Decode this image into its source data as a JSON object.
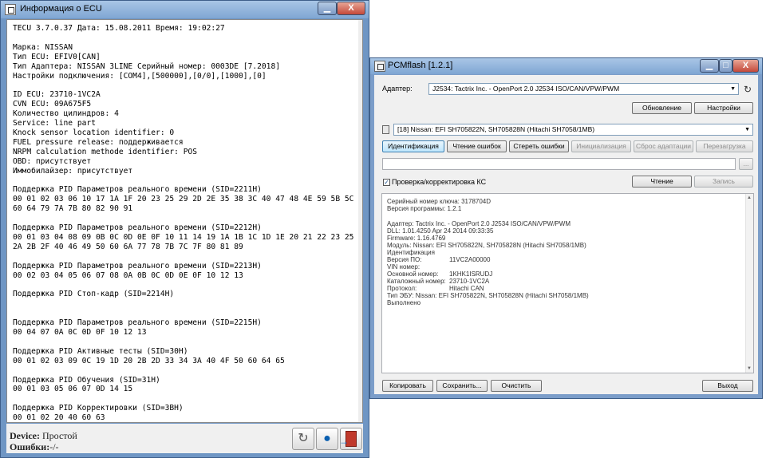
{
  "ecu_window": {
    "title": "Информация о ECU",
    "title_buttons": {
      "minimize": "▁",
      "maximize": "□",
      "close": "X"
    },
    "lines": [
      "TECU 3.7.0.37 Дата: 15.08.2011 Время: 19:02:27",
      "",
      "Марка: NISSAN",
      "Тип ECU: EFIV0[CAN]",
      "Тип Адаптера: NISSAN 3LINE Серийный номер: 0003DE [7.2018]",
      "Настройки подключения: [COM4],[500000],[0/0],[1000],[0]",
      "",
      "ID ECU: 23710-1VC2A",
      "CVN ECU: 09A675F5",
      "Количество цилиндров: 4",
      "Service: line part",
      "Knock sensor location identifier: 0",
      "FUEL pressure release: поддерживается",
      "NRPM calculation methode identifier: POS",
      "OBD: присутствует",
      "Иммобилайзер: присутствует",
      "",
      "Поддержка PID Параметров реального времени (SID=2211H)",
      "00 01 02 03 06 10 17 1A 1F 20 23 25 29 2D 2E 35 38 3C 40 47 48 4E 59 5B 5C",
      "60 64 79 7A 7B 80 82 90 91",
      "",
      "Поддержка PID Параметров реального времени (SID=2212H)",
      "00 01 03 04 08 09 0B 0C 0D 0E 0F 10 11 14 19 1A 1B 1C 1D 1E 20 21 22 23 25",
      "2A 2B 2F 40 46 49 50 60 6A 77 78 7B 7C 7F 80 81 89",
      "",
      "Поддержка PID Параметров реального времени (SID=2213H)",
      "00 02 03 04 05 06 07 08 0A 0B 0C 0D 0E 0F 10 12 13",
      "",
      "Поддержка PID Стоп-кадр (SID=2214H)",
      "",
      "",
      "Поддержка PID Параметров реального времени (SID=2215H)",
      "00 04 07 0A 0C 0D 0F 10 12 13",
      "",
      "Поддержка PID Активные тесты (SID=30H)",
      "00 01 02 03 09 0C 19 1D 20 2B 2D 33 34 3A 40 4F 50 60 64 65",
      "",
      "Поддержка PID Обучения (SID=31H)",
      "00 01 03 05 06 07 0D 14 15",
      "",
      "Поддержка PID Корректировки (SID=3BH)",
      "00 01 02 20 40 60 63"
    ],
    "device_label": "Device:",
    "device_value": "Простой",
    "errors_label": "Ошибки:",
    "errors_value": "-/-"
  },
  "pcm_window": {
    "title": "PCMflash [1.2.1]",
    "title_buttons": {
      "minimize": "▁",
      "maximize": "□",
      "close": "X"
    },
    "adapter_label": "Адаптер:",
    "adapter_value": "J2534: Tactrix Inc. - OpenPort 2.0 J2534 ISO/CAN/VPW/PWM",
    "update_button": "Обновление",
    "settings_button": "Настройки",
    "module_value": "[18] Nissan: EFI SH705822N, SH705828N (Hitachi SH7058/1MB)",
    "tabs": [
      "Идентификация",
      "Чтение ошибок",
      "Стереть ошибки",
      "Инициализация",
      "Сброс адаптации",
      "Перезагрузка"
    ],
    "browse_button": "...",
    "checksum_checkbox_label": "Проверка/корректировка КС",
    "read_button": "Чтение",
    "write_button": "Запись",
    "log": {
      "key_serial": "Серийный номер ключа: 3178704D",
      "program_version": "Версия программы: 1.2.1",
      "adapter_line": "Адаптер: Tactrix Inc. - OpenPort 2.0 J2534 ISO/CAN/VPW/PWM",
      "dll_line": "DLL: 1.01.4250 Apr 24 2014 09:33:35",
      "firmware_line": "Firmware: 1.16.4769",
      "module_line": "Модуль: Nissan: EFI SH705822N, SH705828N (Hitachi SH7058/1MB)",
      "ident_header": "Идентификация",
      "sw_version_label": "Версия ПО:",
      "sw_version_value": "11VC2A00000",
      "vin_label": "VIN номер:",
      "main_number_label": "Основной номер:",
      "main_number_value": "1KHK1ISRUDJ",
      "catalog_number_label": "Каталожный номер:",
      "catalog_number_value": "23710-1VC2A",
      "protocol_label": "Протокол:",
      "protocol_value": "Hitachi CAN",
      "ecu_type_line": "Тип ЭБУ: Nissan: EFI SH705822N, SH705828N (Hitachi SH7058/1MB)",
      "done": "Выполнено"
    },
    "copy_button": "Копировать",
    "save_button": "Сохранить...",
    "clear_button": "Очистить",
    "exit_button": "Выход"
  }
}
